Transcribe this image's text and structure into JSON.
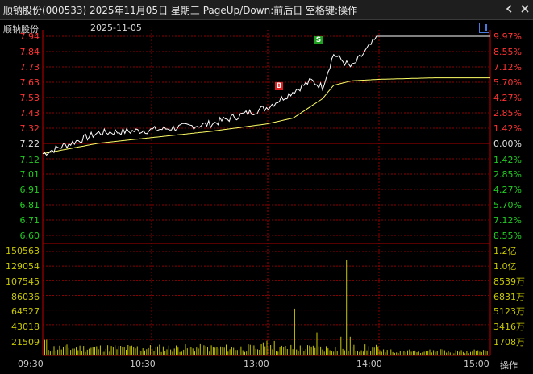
{
  "window": {
    "title": "顺钠股份(000533) 2025年11月05日 星期三 PageUp/Down:前后日 空格键:操作"
  },
  "chart_header": {
    "stock_name": "顺钠股份",
    "date": "2025-11-05"
  },
  "colors": {
    "up": "#ff3333",
    "down": "#22cc22",
    "price": "#ffffff",
    "avg": "#ffff66",
    "volume": "#c8c800",
    "grid": "#8b0000"
  },
  "icons": [
    "back-arrow-icon",
    "close-icon",
    "panel-toggle-icon"
  ],
  "price_axis": {
    "left": [
      "7.94",
      "7.84",
      "7.73",
      "7.63",
      "7.53",
      "7.43",
      "7.32",
      "7.22",
      "7.12",
      "7.01",
      "6.91",
      "6.81",
      "6.71",
      "6.60"
    ],
    "right": [
      "9.97%",
      "8.55%",
      "7.12%",
      "5.70%",
      "4.27%",
      "2.85%",
      "1.42%",
      "0.00%",
      "1.42%",
      "2.85%",
      "4.27%",
      "5.70%",
      "7.12%",
      "8.55%"
    ]
  },
  "volume_axis": {
    "left": [
      "150563",
      "129054",
      "107545",
      "86036",
      "64527",
      "43018",
      "21509"
    ],
    "right": [
      "1.2亿",
      "1.0亿",
      "8539万",
      "6831万",
      "5123万",
      "3416万",
      "1708万"
    ]
  },
  "time_axis": [
    "09:30",
    "10:30",
    "13:00",
    "14:00",
    "15:00"
  ],
  "footer": {
    "ops_label": "操作"
  },
  "markers": {
    "buy": "B",
    "sell": "S"
  },
  "chart_data": {
    "type": "line",
    "title": "顺钠股份 2025-11-05",
    "prev_close": 7.22,
    "ylim": [
      6.6,
      7.94
    ],
    "x": [
      "09:30",
      "10:00",
      "10:30",
      "11:00",
      "11:30/13:00",
      "13:15",
      "13:25",
      "13:30",
      "13:35",
      "13:45",
      "14:00",
      "14:30",
      "15:00"
    ],
    "series": [
      {
        "values": [
          7.15,
          7.29,
          7.31,
          7.35,
          7.46,
          7.57,
          7.64,
          7.6,
          7.82,
          7.73,
          7.94,
          7.94,
          7.94
        ]
      },
      {
        "values": [
          7.15,
          7.22,
          7.26,
          7.3,
          7.35,
          7.39,
          7.47,
          7.52,
          7.61,
          7.64,
          7.65,
          7.66,
          7.66
        ]
      }
    ],
    "volume_max": 150563
  }
}
